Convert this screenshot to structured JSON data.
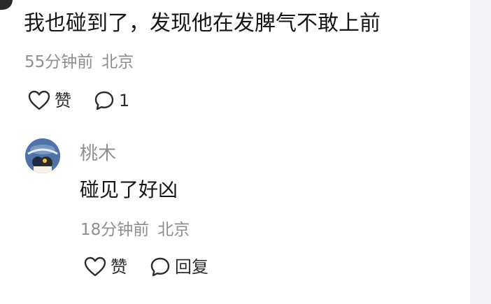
{
  "comment": {
    "text": "我也碰到了，发现他在发脾气不敢上前",
    "time": "55分钟前",
    "location": "北京",
    "like_label": "赞",
    "reply_count": "1"
  },
  "reply": {
    "author": "桃木",
    "text": "碰见了好凶",
    "time": "18分钟前",
    "location": "北京",
    "like_label": "赞",
    "reply_label": "回复"
  },
  "icons": {
    "like": "heart-outline-icon",
    "comment": "speech-bubble-outline-icon"
  },
  "colors": {
    "primary_text": "#161616",
    "meta_text": "#8e8e93",
    "background": "#ffffff"
  }
}
